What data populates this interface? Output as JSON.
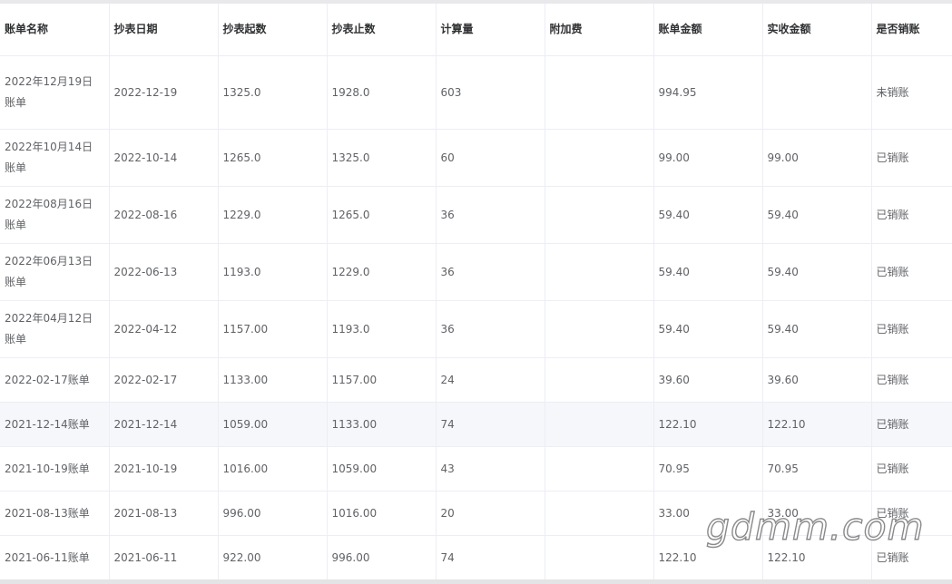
{
  "table": {
    "headers": [
      "账单名称",
      "抄表日期",
      "抄表起数",
      "抄表止数",
      "计算量",
      "附加费",
      "账单金额",
      "实收金额",
      "是否销账"
    ],
    "rows": [
      {
        "name": "2022年12月19日账单",
        "date": "2022-12-19",
        "start": "1325.0",
        "end": "1928.0",
        "qty": "603",
        "extra": "",
        "amount": "994.95",
        "received": "",
        "status": "未销账"
      },
      {
        "name": "2022年10月14日账单",
        "date": "2022-10-14",
        "start": "1265.0",
        "end": "1325.0",
        "qty": "60",
        "extra": "",
        "amount": "99.00",
        "received": "99.00",
        "status": "已销账"
      },
      {
        "name": "2022年08月16日账单",
        "date": "2022-08-16",
        "start": "1229.0",
        "end": "1265.0",
        "qty": "36",
        "extra": "",
        "amount": "59.40",
        "received": "59.40",
        "status": "已销账"
      },
      {
        "name": "2022年06月13日账单",
        "date": "2022-06-13",
        "start": "1193.0",
        "end": "1229.0",
        "qty": "36",
        "extra": "",
        "amount": "59.40",
        "received": "59.40",
        "status": "已销账"
      },
      {
        "name": "2022年04月12日账单",
        "date": "2022-04-12",
        "start": "1157.00",
        "end": "1193.0",
        "qty": "36",
        "extra": "",
        "amount": "59.40",
        "received": "59.40",
        "status": "已销账"
      },
      {
        "name": "2022-02-17账单",
        "date": "2022-02-17",
        "start": "1133.00",
        "end": "1157.00",
        "qty": "24",
        "extra": "",
        "amount": "39.60",
        "received": "39.60",
        "status": "已销账"
      },
      {
        "name": "2021-12-14账单",
        "date": "2021-12-14",
        "start": "1059.00",
        "end": "1133.00",
        "qty": "74",
        "extra": "",
        "amount": "122.10",
        "received": "122.10",
        "status": "已销账"
      },
      {
        "name": "2021-10-19账单",
        "date": "2021-10-19",
        "start": "1016.00",
        "end": "1059.00",
        "qty": "43",
        "extra": "",
        "amount": "70.95",
        "received": "70.95",
        "status": "已销账"
      },
      {
        "name": "2021-08-13账单",
        "date": "2021-08-13",
        "start": "996.00",
        "end": "1016.00",
        "qty": "20",
        "extra": "",
        "amount": "33.00",
        "received": "33.00",
        "status": "已销账"
      },
      {
        "name": "2021-06-11账单",
        "date": "2021-06-11",
        "start": "922.00",
        "end": "996.00",
        "qty": "74",
        "extra": "",
        "amount": "122.10",
        "received": "122.10",
        "status": "已销账"
      }
    ]
  },
  "watermark": {
    "text": "gdmm.com"
  }
}
